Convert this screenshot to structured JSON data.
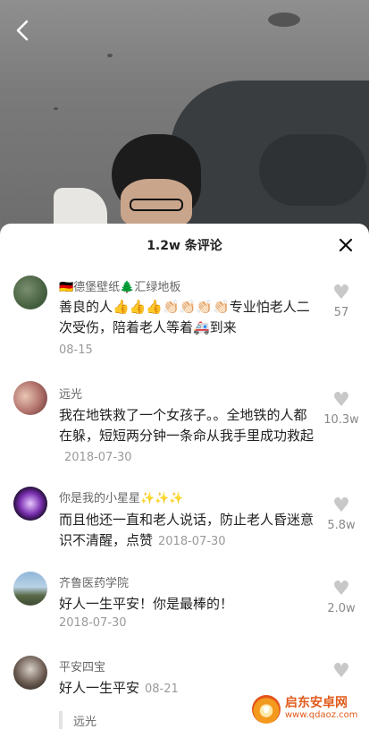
{
  "header": {
    "back_icon": "back-arrow-icon"
  },
  "comments_sheet": {
    "title": "1.2w 条评论",
    "close_icon": "close-icon",
    "comments": [
      {
        "username": "🇩🇪德堡壁纸🌲汇绿地板",
        "text": "善良的人👍👍👍👏🏻👏🏻👏🏻👏🏻专业怕老人二次受伤，陪着老人等着🚑到来",
        "date": "08-15",
        "likes": "57"
      },
      {
        "username": "远光",
        "text": "我在地铁救了一个女孩子。。全地铁的人都在躲，短短两分钟一条命从我手里成功救起",
        "date": "2018-07-30",
        "likes": "10.3w"
      },
      {
        "username": "你是我的小星星✨✨✨",
        "text": "而且他还一直和老人说话，防止老人昏迷意识不清醒，点赞",
        "date": "2018-07-30",
        "likes": "5.8w"
      },
      {
        "username": "齐鲁医药学院",
        "text": "好人一生平安！你是最棒的！",
        "date": "2018-07-30",
        "likes": "2.0w"
      },
      {
        "username": "平安四宝",
        "text": "好人一生平安",
        "date": "08-21",
        "likes": ""
      }
    ],
    "reply_preview_name": "远光"
  },
  "watermark": {
    "name": "启东安卓网",
    "url": "www.qdaoz.com"
  },
  "colors": {
    "heart": "#c8c8c8",
    "watermark": "#e05a1a"
  }
}
